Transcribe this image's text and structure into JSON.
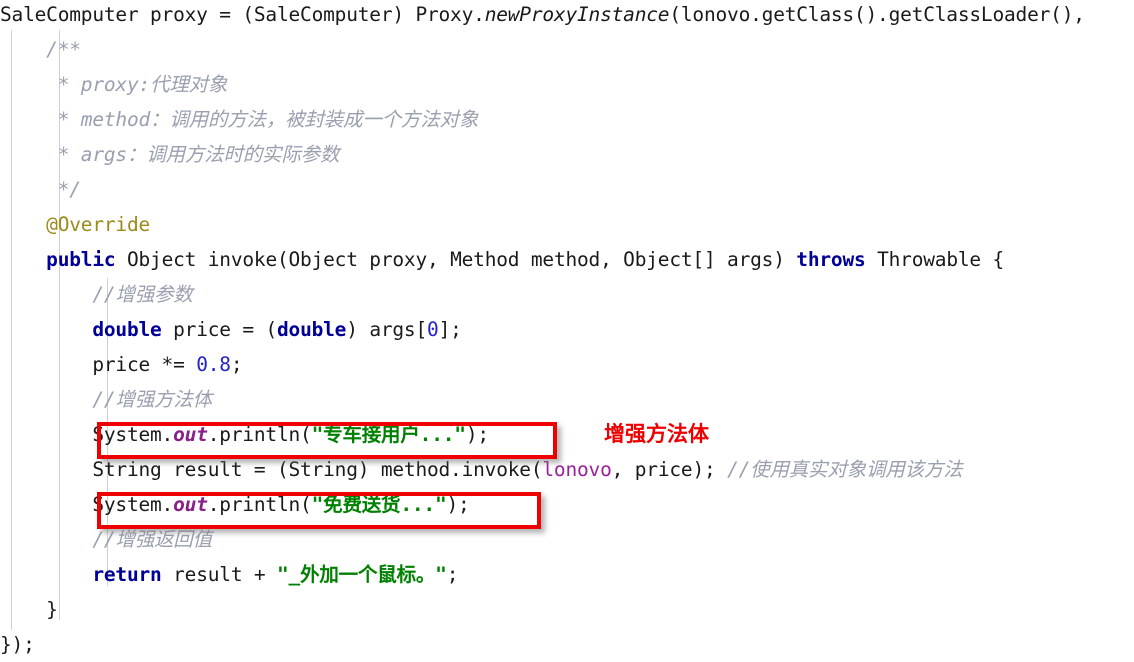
{
  "editor": {
    "background_color": "#ffffff",
    "default_text_color": "#1a1a1a",
    "keyword_color": "#000098",
    "string_color": "#008000",
    "comment_color": "#9aa0b0",
    "number_color": "#2222cc",
    "field_color": "#9b1f9b",
    "annotation_color": "#9a8b1a",
    "highlight_color": "#ee0000",
    "language": "Java"
  },
  "code": {
    "line_01": {
      "t1": "SaleComputer proxy = (SaleComputer) Proxy.",
      "t2": "newProxyInstance",
      "t3": "(lonovo.getClass().getClassLoader(),"
    },
    "line_02": {
      "t1": "    /**"
    },
    "line_03": {
      "t1": "     * proxy:代理对象"
    },
    "line_04": {
      "t1": "     * method：调用的方法，被封装成一个方法对象"
    },
    "line_05": {
      "t1": "     * args：调用方法时的实际参数"
    },
    "line_06": {
      "t1": "     */"
    },
    "line_07": {
      "t1": "    ",
      "t2": "@Override"
    },
    "line_08": {
      "t1": "    ",
      "t2": "public",
      "t3": " Object invoke(Object proxy, Method method, Object[] args) ",
      "t4": "throws",
      "t5": " Throwable {"
    },
    "line_09": {
      "t1": "        ",
      "t2": "//增强参数"
    },
    "line_10": {
      "t1": "        ",
      "t2": "double",
      "t3": " price = (",
      "t4": "double",
      "t5": ") args[",
      "t6": "0",
      "t7": "];"
    },
    "line_11": {
      "t1": "        price *= ",
      "t2": "0.8",
      "t3": ";"
    },
    "line_12": {
      "t1": "        ",
      "t2": "//增强方法体"
    },
    "line_13": {
      "t1": "        System.",
      "t2": "out",
      "t3": ".println(",
      "t4": "\"专车接用户...\"",
      "t5": ");"
    },
    "line_14": {
      "t1": "        String result = (String) method.invoke(",
      "t2": "lonovo",
      "t3": ", ",
      "t4": "price",
      "t5": "); ",
      "t6": "//使用真实对象调用该方法"
    },
    "line_15": {
      "t1": "        System.",
      "t2": "out",
      "t3": ".println(",
      "t4": "\"免费送货...\"",
      "t5": ");"
    },
    "line_16": {
      "t1": "        ",
      "t2": "//增强返回值"
    },
    "line_17": {
      "t1": "        ",
      "t2": "return",
      "t3": " result + ",
      "t4": "\"_外加一个鼠标。\"",
      "t5": ";"
    },
    "line_18": {
      "t1": "    }"
    },
    "line_19": {
      "t1": "});"
    }
  },
  "annotations": {
    "callout_1": "增强方法体"
  }
}
